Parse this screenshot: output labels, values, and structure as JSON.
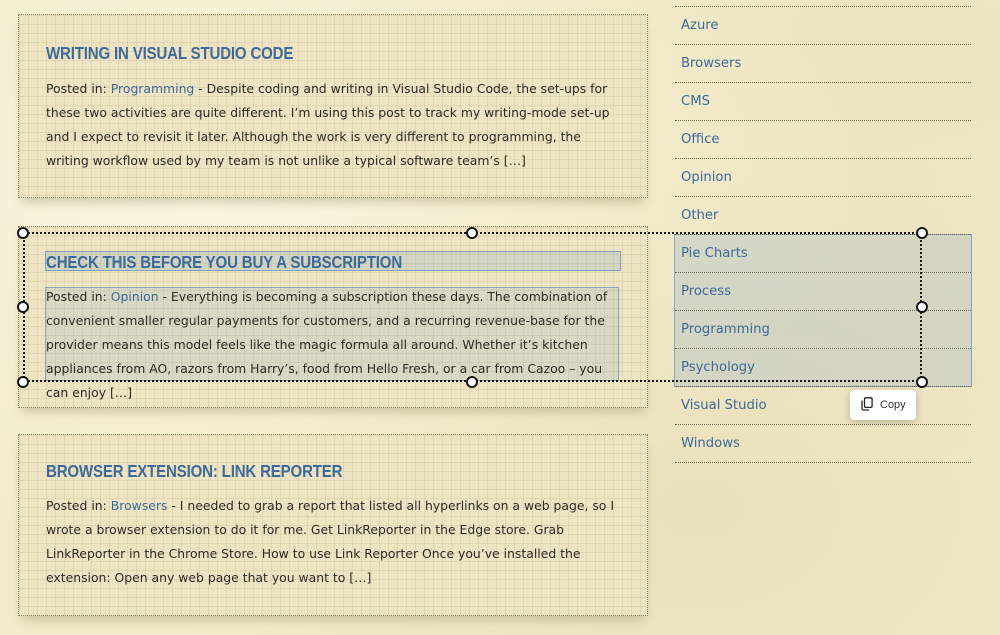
{
  "posts": [
    {
      "title": "Writing in Visual Studio Code",
      "posted_in_label": "Posted in:",
      "category": "Programming",
      "excerpt": " - Despite coding and writing in Visual Studio Code, the set-ups for these two activities are quite different. I’m using this post to track my writing-mode set-up and I expect to revisit it later. Although the work is very different to programming, the writing workflow used by my team is not unlike a typical software team’s […]"
    },
    {
      "title": "Check this before you buy a subscription",
      "posted_in_label": "Posted in:",
      "category": "Opinion",
      "excerpt": " - Everything is becoming a subscription these days. The combination of convenient smaller regular payments for customers, and a recurring revenue-base for the provider means this model feels like the magic formula all around. Whether it’s kitchen appliances from AO, razors from Harry’s, food from Hello Fresh, or a car from Cazoo – you can enjoy […]"
    },
    {
      "title": "Browser Extension: Link Reporter",
      "posted_in_label": "Posted in:",
      "category": "Browsers",
      "excerpt": " - I needed to grab a report that listed all hyperlinks on a web page, so I wrote a browser extension to do it for me. Get LinkReporter in the Edge store. Grab LinkReporter in the Chrome Store. How to use Link Reporter Once you’ve installed the extension: Open any web page that you want to […]"
    }
  ],
  "categories": [
    "Azure",
    "Browsers",
    "CMS",
    "Office",
    "Opinion",
    "Other",
    "Pie Charts",
    "Process",
    "Programming",
    "Psychology",
    "Visual Studio",
    "Windows"
  ],
  "snip_toolbar": {
    "copy_label": "Copy",
    "copy_icon": "copy-icon"
  },
  "colors": {
    "link": "#3d6a9b",
    "background": "#f2eaca",
    "selection": "#78a0c8"
  }
}
